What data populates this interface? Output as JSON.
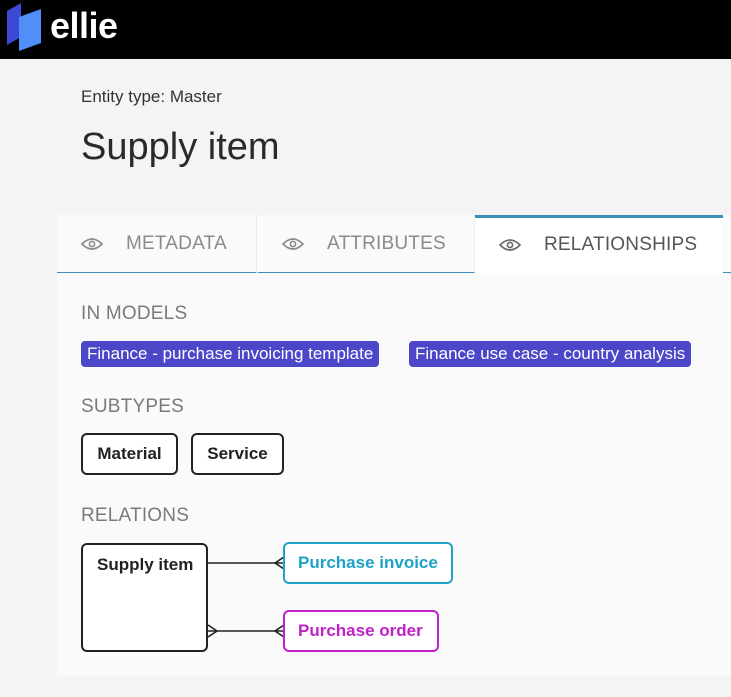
{
  "app": {
    "brand": "ellie",
    "logo_icon": "ellie-logo-icon"
  },
  "header": {
    "entity_type": "Entity type: Master",
    "title": "Supply item"
  },
  "tabs": [
    {
      "label": "METADATA",
      "icon": "eye-icon",
      "active": false
    },
    {
      "label": "ATTRIBUTES",
      "icon": "eye-icon",
      "active": false
    },
    {
      "label": "RELATIONSHIPS",
      "icon": "eye-icon",
      "active": true
    }
  ],
  "in_models": {
    "heading": "IN MODELS",
    "items": [
      "Finance - purchase invoicing template",
      "Finance use case - country analysis"
    ]
  },
  "subtypes": {
    "heading": "SUBTYPES",
    "items": [
      "Material",
      "Service"
    ]
  },
  "relations": {
    "heading": "RELATIONS",
    "source": "Supply item",
    "targets": [
      {
        "label": "Purchase invoice",
        "color": "#1fa2c8"
      },
      {
        "label": "Purchase order",
        "color": "#c021c8"
      }
    ]
  },
  "colors": {
    "topbar": "#000000",
    "model_tag": "#4c46c8",
    "tab_accent": "#3a8fb8",
    "logo_light": "#4f8ff7",
    "logo_dark": "#3b49d6"
  }
}
